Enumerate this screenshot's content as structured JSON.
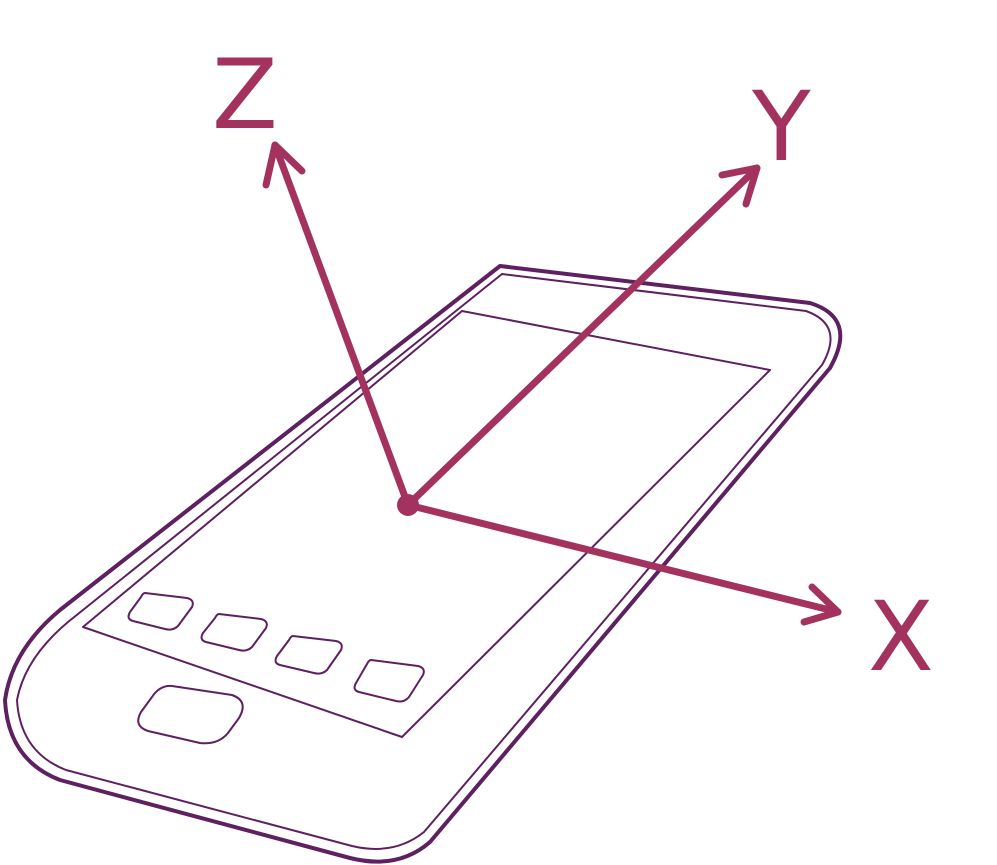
{
  "axes": {
    "x": "X",
    "y": "Y",
    "z": "Z"
  },
  "colors": {
    "device_outline": "#5e2060",
    "axis": "#a3335e",
    "background": "#ffffff"
  },
  "device": {
    "icon": "smartphone-icon",
    "app_icon_count": 4
  }
}
